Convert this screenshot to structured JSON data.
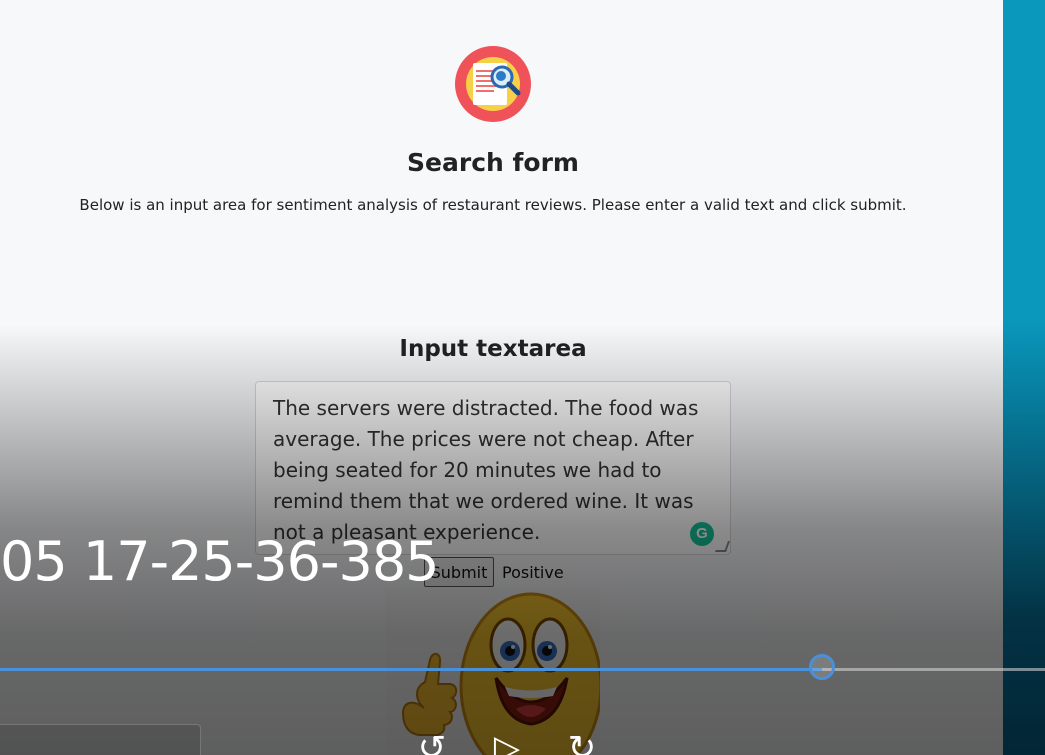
{
  "header": {
    "title": "Search form",
    "description": "Below is an input area for sentiment analysis of restaurant reviews. Please enter a valid text and click submit."
  },
  "form": {
    "section_title": "Input textarea",
    "textarea_value": "The servers were distracted. The food was average. The prices were not cheap. After being seated for 20 minutes we had to remind them that we ordered wine. It was not a pleasant experience.",
    "submit_label": "Submit",
    "result": "Positive"
  },
  "media_overlay": {
    "timestamp": "05 17-25-36-385",
    "progress_fraction": 0.787
  },
  "colors": {
    "progress": "#4a90d9",
    "logo_ring": "#f0525a",
    "logo_inner": "#f7d047",
    "side_strip": "#0a98bd"
  },
  "icons": {
    "logo": "document-search-icon",
    "grammarly": "grammarly-icon",
    "emoji": "thumbs-up-smiley-icon",
    "rewind": "rewind-icon",
    "play": "play-icon",
    "forward": "forward-icon"
  }
}
